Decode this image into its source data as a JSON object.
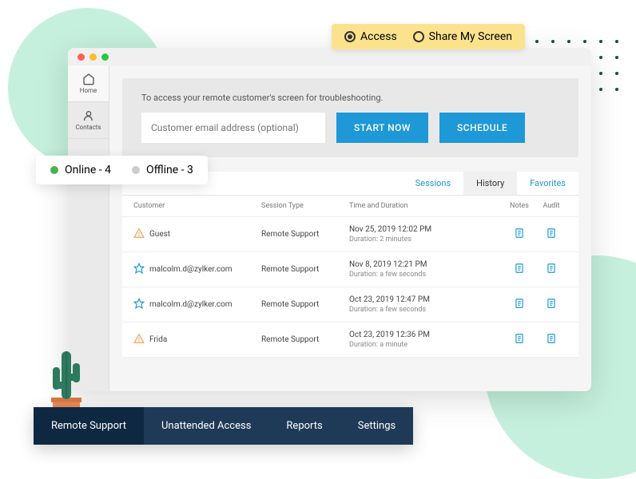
{
  "pill": {
    "access": "Access",
    "share": "Share My Screen"
  },
  "sidebar": {
    "home": "Home",
    "contacts": "Contacts"
  },
  "access_box": {
    "instruction": "To access your remote customer's screen for troubleshooting.",
    "placeholder": "Customer email address (optional)",
    "start": "START NOW",
    "schedule": "SCHEDULE"
  },
  "status": {
    "online": "Online - 4",
    "offline": "Offline - 3"
  },
  "tabs": {
    "sessions": "Sessions",
    "history": "History",
    "favorites": "Favorites"
  },
  "columns": {
    "customer": "Customer",
    "session_type": "Session Type",
    "time": "Time and Duration",
    "notes": "Notes",
    "audit": "Audit"
  },
  "rows": [
    {
      "customer": "Guest",
      "type": "Remote Support",
      "time": "Nov 25, 2019 12:02 PM",
      "duration": "Duration: 2 minutes",
      "icon": "warn"
    },
    {
      "customer": "malcolm.d@zylker.com",
      "type": "Remote Support",
      "time": "Nov 8, 2019 12:21 PM",
      "duration": "Duration: a few seconds",
      "icon": "star"
    },
    {
      "customer": "malcolm.d@zylker.com",
      "type": "Remote Support",
      "time": "Oct 23, 2019 12:47 PM",
      "duration": "Duration: a few seconds",
      "icon": "star"
    },
    {
      "customer": "Frida",
      "type": "Remote Support",
      "time": "Oct 23, 2019 12:36 PM",
      "duration": "Duration: a minute",
      "icon": "warn"
    }
  ],
  "bottom_nav": {
    "remote": "Remote Support",
    "unattended": "Unattended Access",
    "reports": "Reports",
    "settings": "Settings"
  }
}
